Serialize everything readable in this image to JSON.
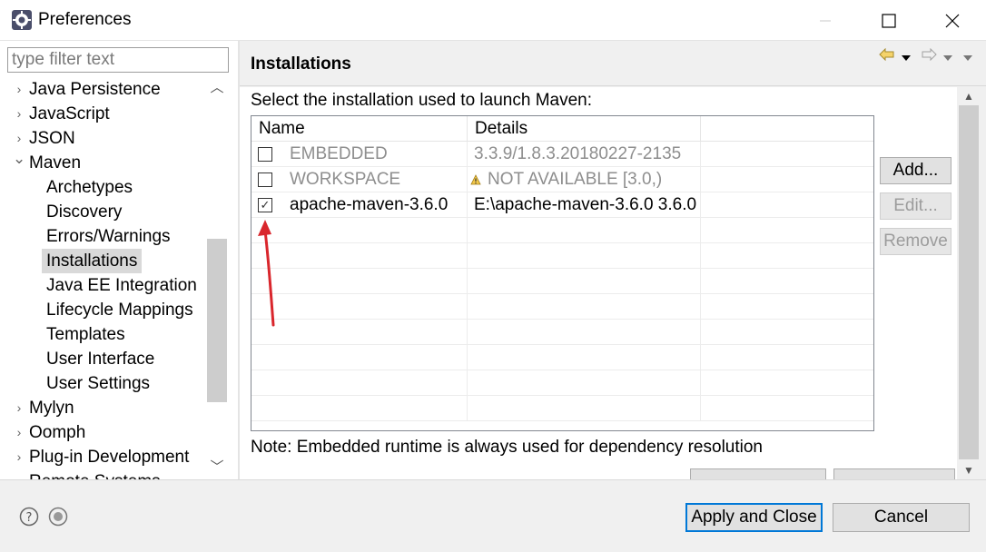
{
  "window": {
    "title": "Preferences"
  },
  "filter": {
    "placeholder": "type filter text",
    "value": ""
  },
  "tree": {
    "items": [
      {
        "label": "Java Persistence",
        "level": 0,
        "expanded": false
      },
      {
        "label": "JavaScript",
        "level": 0,
        "expanded": false
      },
      {
        "label": "JSON",
        "level": 0,
        "expanded": false
      },
      {
        "label": "Maven",
        "level": 0,
        "expanded": true
      },
      {
        "label": "Archetypes",
        "level": 1
      },
      {
        "label": "Discovery",
        "level": 1
      },
      {
        "label": "Errors/Warnings",
        "level": 1
      },
      {
        "label": "Installations",
        "level": 1,
        "selected": true
      },
      {
        "label": "Java EE Integration",
        "level": 1
      },
      {
        "label": "Lifecycle Mappings",
        "level": 1
      },
      {
        "label": "Templates",
        "level": 1
      },
      {
        "label": "User Interface",
        "level": 1
      },
      {
        "label": "User Settings",
        "level": 1
      },
      {
        "label": "Mylyn",
        "level": 0,
        "expanded": false
      },
      {
        "label": "Oomph",
        "level": 0,
        "expanded": false
      },
      {
        "label": "Plug-in Development",
        "level": 0,
        "expanded": false
      },
      {
        "label": "Remote Systems",
        "level": 0,
        "expanded": false
      }
    ]
  },
  "page": {
    "title": "Installations",
    "prompt": "Select the installation used to launch Maven:",
    "columns": [
      "Name",
      "Details"
    ],
    "rows": [
      {
        "checked": false,
        "name": "EMBEDDED",
        "details": "3.3.9/1.8.3.20180227-2135",
        "disabled": true,
        "warning": false
      },
      {
        "checked": false,
        "name": "WORKSPACE",
        "details": "NOT AVAILABLE [3.0,)",
        "disabled": true,
        "warning": true
      },
      {
        "checked": true,
        "name": "apache-maven-3.6.0",
        "details": "E:\\apache-maven-3.6.0 3.6.0",
        "disabled": false,
        "warning": false
      }
    ],
    "buttons": {
      "add": "Add...",
      "edit": "Edit...",
      "remove": "Remove"
    },
    "note": "Note: Embedded runtime is always used for dependency resolution"
  },
  "footer": {
    "apply_close": "Apply and Close",
    "cancel": "Cancel"
  },
  "colors": {
    "annotation_arrow": "#d9262c",
    "focus_border": "#0078d7",
    "selection": "#d9d9d9"
  }
}
